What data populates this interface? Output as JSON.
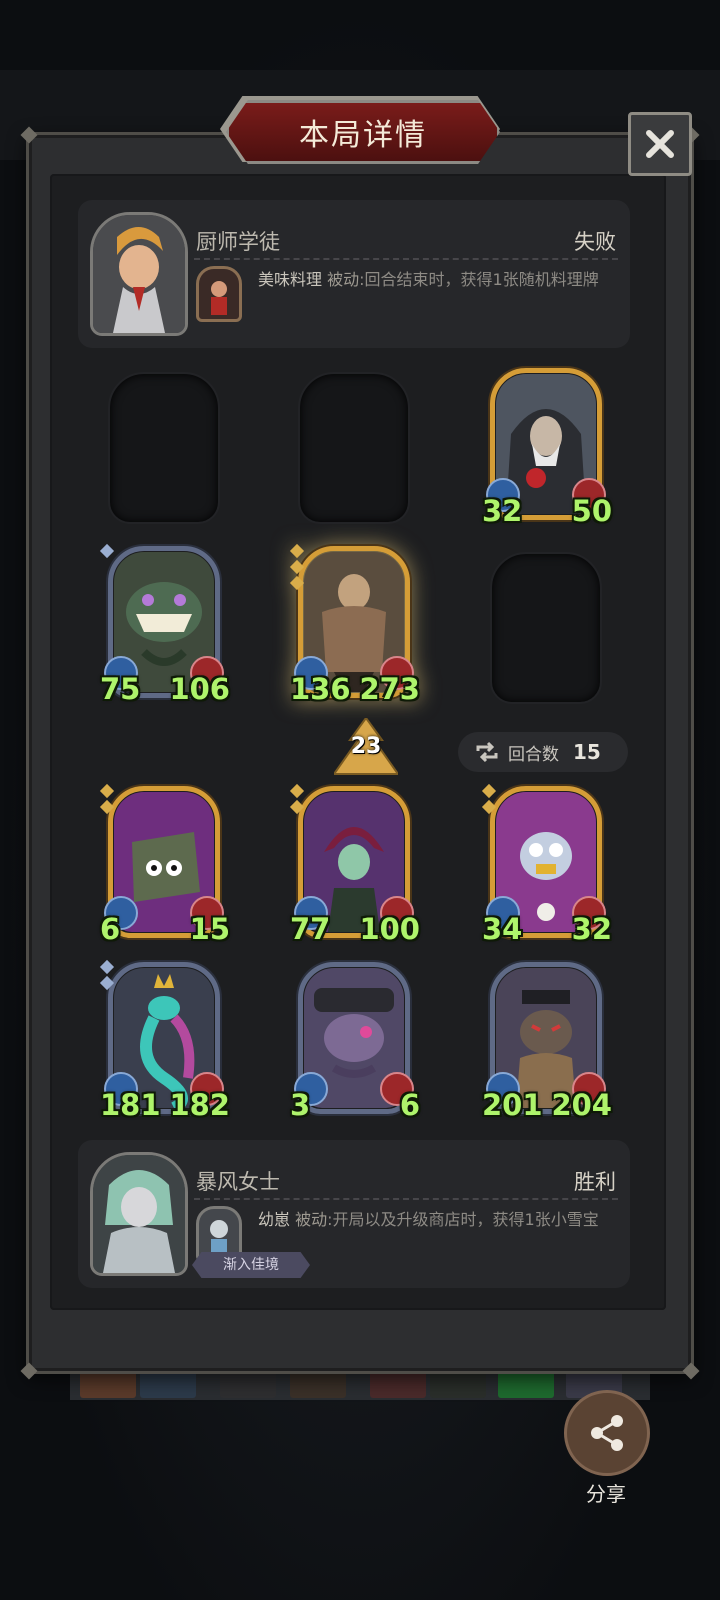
{
  "title": "本局详情",
  "close_icon": "close-icon",
  "top_player": {
    "name": "厨师学徒",
    "result": "失败",
    "skill_name": "美味料理",
    "skill_type": "被动",
    "skill_desc": ":回合结束时，获得1张随机料理牌"
  },
  "bottom_player": {
    "name": "暴风女士",
    "result": "胜利",
    "skill_name": "幼崽",
    "skill_type": "被动",
    "skill_desc": ":开局以及升级商店时，获得1张小雪宝",
    "tag": "渐入佳境"
  },
  "top_board": [
    {
      "empty": true
    },
    {
      "empty": true
    },
    {
      "attack": "32",
      "health": "50"
    },
    {
      "attack": "75",
      "health": "106"
    },
    {
      "attack": "136",
      "health": "273"
    },
    {
      "empty": true
    }
  ],
  "tier": "23",
  "turns": {
    "label": "回合数",
    "value": "15"
  },
  "bottom_board": [
    {
      "attack": "6",
      "health": "15"
    },
    {
      "attack": "77",
      "health": "100"
    },
    {
      "attack": "34",
      "health": "32"
    },
    {
      "attack": "181",
      "health": "182"
    },
    {
      "attack": "3",
      "health": "6"
    },
    {
      "attack": "201",
      "health": "204"
    }
  ],
  "share_label": "分享",
  "colors": {
    "gold_frame": "#d59d37",
    "silver_frame": "#5f6a86",
    "stat_text": "#aef46b",
    "banner": "#7a1c1a"
  }
}
